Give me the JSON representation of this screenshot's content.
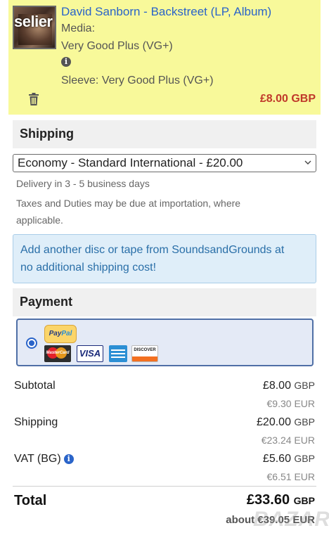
{
  "cart_item": {
    "seller_tag": "selier",
    "title": "David Sanborn - Backstreet (LP, Album)",
    "media_label": "Media:",
    "media_condition": "Very Good Plus (VG+)",
    "sleeve_condition": "Sleeve: Very Good Plus (VG+)",
    "price": "£8.00 GBP"
  },
  "shipping": {
    "heading": "Shipping",
    "selected_option": "Economy - Standard International - £20.00",
    "delivery_note": "Delivery in 3 - 5 business days",
    "taxes_note_line1": "Taxes and Duties may be due at importation, where",
    "taxes_note_line2": "applicable.",
    "promo_line1": "Add another disc or tape from SoundsandGrounds at",
    "promo_line2": "no additional shipping cost!"
  },
  "payment": {
    "heading": "Payment",
    "paypal_pay": "Pay",
    "paypal_pal": "Pal",
    "mastercard_label": "MasterCard",
    "visa_label": "VISA",
    "discover_label": "DISCOVER",
    "selected": true
  },
  "totals": {
    "subtotal_label": "Subtotal",
    "subtotal_gbp": "£8.00",
    "subtotal_eur": "€9.30 EUR",
    "shipping_label": "Shipping",
    "shipping_gbp": "£20.00",
    "shipping_eur": "€23.24 EUR",
    "vat_label": "VAT (BG)",
    "vat_gbp": "£5.60",
    "vat_eur": "€6.51 EUR",
    "gbp_unit": "GBP",
    "total_label": "Total",
    "total_gbp": "£33.60",
    "total_eur": "about €39.05 EUR"
  },
  "watermark": "BAZAR",
  "colors": {
    "item_bg": "#f8f99a",
    "link": "#2a64c9",
    "price": "#c0392b",
    "promo_bg": "#dfeef9",
    "payment_box_bg": "#e4eaf6"
  }
}
